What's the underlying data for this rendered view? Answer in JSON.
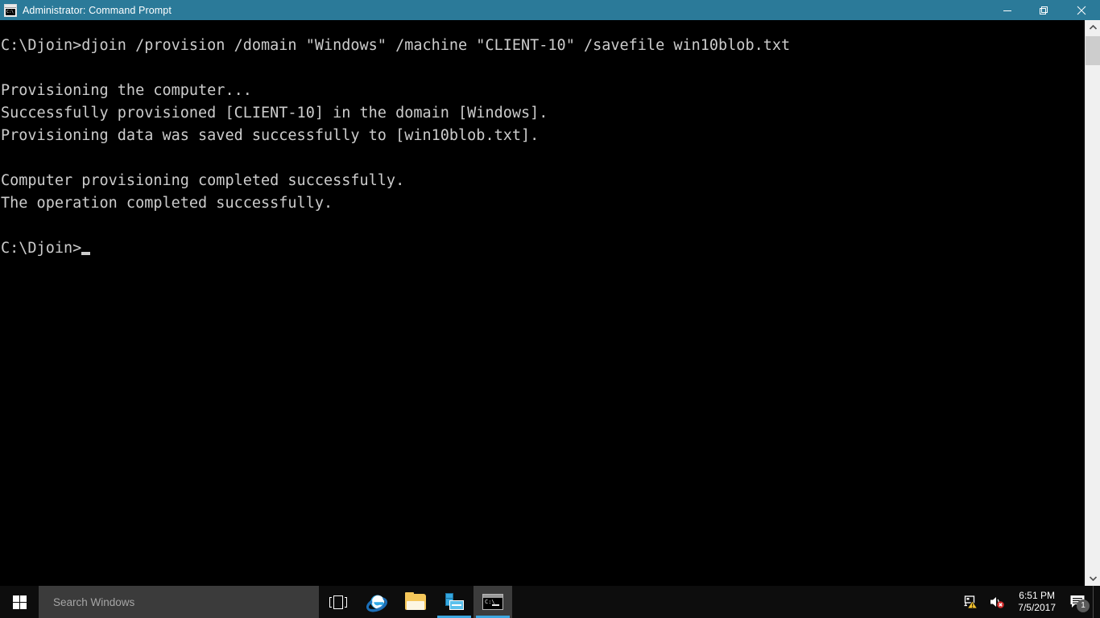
{
  "window": {
    "title": "Administrator: Command Prompt",
    "icon": "console-icon",
    "icon_text": "C:\\",
    "titlebar_color": "#2b7a99",
    "controls": {
      "minimize": "minimize-button",
      "restore": "restore-button",
      "close": "close-button"
    }
  },
  "console": {
    "background": "#000000",
    "foreground": "#cccccc",
    "lines": [
      "C:\\Djoin>djoin /provision /domain \"Windows\" /machine \"CLIENT-10\" /savefile win10blob.txt",
      "",
      "Provisioning the computer...",
      "Successfully provisioned [CLIENT-10] in the domain [Windows].",
      "Provisioning data was saved successfully to [win10blob.txt].",
      "",
      "Computer provisioning completed successfully.",
      "The operation completed successfully.",
      ""
    ],
    "prompt": "C:\\Djoin>",
    "cursor": "underscore-block"
  },
  "scrollbar": {
    "up_arrow": "chevron-up-icon",
    "down_arrow": "chevron-down-icon",
    "thumb_color": "#cdcdcd",
    "track_color": "#f0f0f0"
  },
  "taskbar": {
    "background": "#0d0d0d",
    "start": {
      "label": "Start",
      "icon": "windows-logo-icon"
    },
    "search": {
      "placeholder": "Search Windows",
      "value": "",
      "background": "#3b3b3b"
    },
    "items": [
      {
        "name": "task-view",
        "icon": "task-view-icon",
        "label": "Task View",
        "active": false,
        "running": false
      },
      {
        "name": "internet-explorer",
        "icon": "internet-explorer-icon",
        "label": "Internet Explorer",
        "active": false,
        "running": false
      },
      {
        "name": "file-explorer",
        "icon": "folder-icon",
        "label": "File Explorer",
        "active": false,
        "running": false
      },
      {
        "name": "server-manager",
        "icon": "server-manager-icon",
        "label": "Server Manager",
        "active": false,
        "running": true
      },
      {
        "name": "command-prompt",
        "icon": "command-prompt-icon",
        "label": "Administrator: Command Prompt",
        "active": true,
        "running": true
      }
    ],
    "tray": {
      "network": {
        "icon": "network-warning-icon",
        "status": "warning"
      },
      "volume": {
        "icon": "speaker-muted-icon",
        "status": "muted"
      },
      "clock": {
        "time": "6:51 PM",
        "date": "7/5/2017"
      },
      "action_center": {
        "icon": "action-center-icon",
        "badge": "1"
      }
    },
    "accent_color": "#3da7e0"
  }
}
